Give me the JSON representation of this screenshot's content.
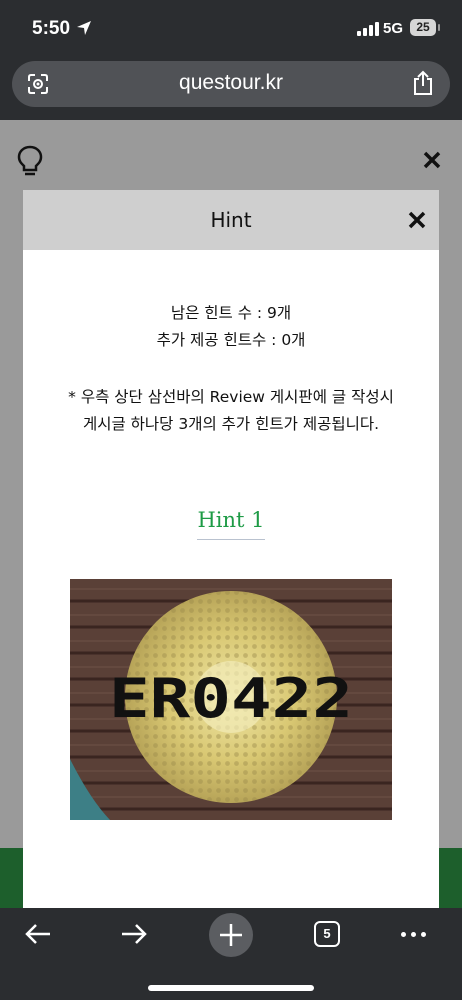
{
  "status_bar": {
    "time": "5:50",
    "network": "5G",
    "battery": "25"
  },
  "browser": {
    "url": "questour.kr",
    "tab_count": "5"
  },
  "modal": {
    "title": "Hint",
    "remaining_hints": "남은 힌트 수 : 9개",
    "extra_hints": "추가 제공 힌트수 : 0개",
    "note_line1": "* 우측 상단 삼선바의 Review 게시판에 글 작성시",
    "note_line2": "게시글 하나당 3개의 추가 힌트가 제공됩니다.",
    "hint_title": "Hint 1",
    "image_text": "ER0422"
  },
  "colors": {
    "hint_green": "#1e9b46",
    "footer_green": "#1d5f2c"
  },
  "icons": {
    "page_left": "lightbulb-icon",
    "page_right": "close-icon"
  }
}
